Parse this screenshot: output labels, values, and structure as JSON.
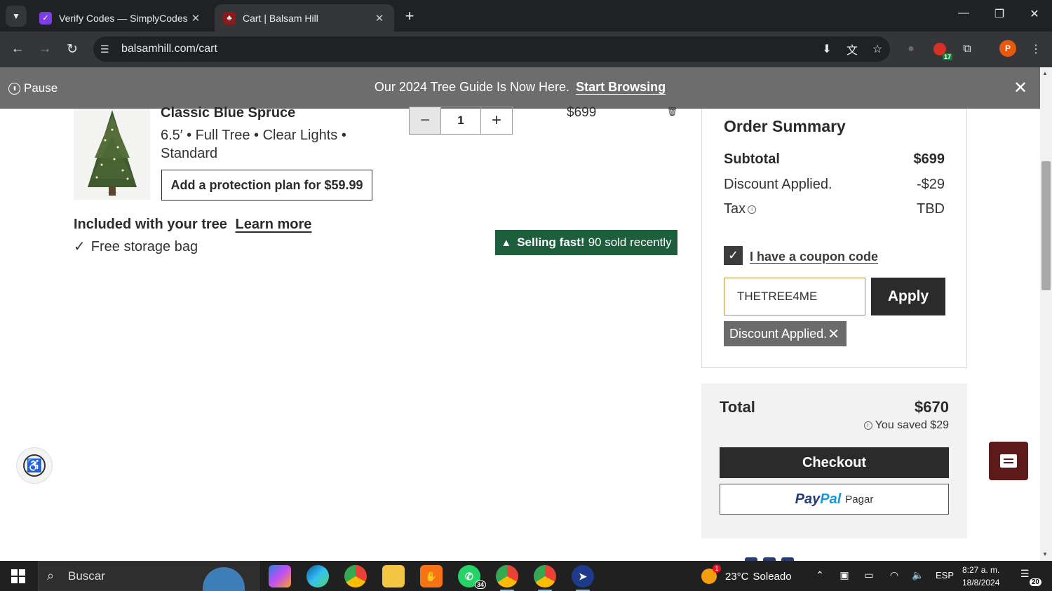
{
  "browser": {
    "tabs": [
      {
        "title": "Verify Codes — SimplyCodes",
        "favicon": "simplycodes-icon",
        "active": false
      },
      {
        "title": "Cart | Balsam Hill",
        "favicon": "balsamhill-icon",
        "active": true
      }
    ],
    "url": "balsamhill.com/cart",
    "extension_badge": "17",
    "profile_initial": "P"
  },
  "promo": {
    "pause_label": "Pause",
    "text": "Our 2024 Tree Guide Is Now Here.",
    "link": "Start Browsing"
  },
  "cart_item": {
    "name": "Classic Blue Spruce",
    "options": "6.5′  •  Full Tree  •  Clear Lights  •  Standard",
    "protection_label": "Add a protection plan for $59.99",
    "quantity": "1",
    "minus": "−",
    "plus": "+",
    "price": "$699",
    "included_title": "Included with your tree",
    "learn_more": "Learn more",
    "included_item": "Free storage bag",
    "selling_bold": "Selling fast!",
    "selling_rest": "90 sold recently"
  },
  "summary": {
    "title": "Order Summary",
    "subtotal_label": "Subtotal",
    "subtotal_value": "$699",
    "discount_label": "Discount Applied.",
    "discount_value": "-$29",
    "tax_label": "Tax",
    "tax_value": "TBD",
    "coupon_label": "I have a coupon code",
    "coupon_checked": true,
    "coupon_value": "THETREE4ME",
    "apply_label": "Apply",
    "chip_label": "Discount Applied."
  },
  "total": {
    "label": "Total",
    "value": "$670",
    "saved": "You saved $29",
    "checkout_label": "Checkout",
    "paypal_pay": "Pay",
    "paypal_pal": "Pal",
    "paypal_text": "Pagar"
  },
  "taskbar": {
    "search_placeholder": "Buscar",
    "whatsapp_badge": "34",
    "weather_temp": "23°C",
    "weather_desc": "Soleado",
    "lang": "ESP",
    "time": "8:27 a. m.",
    "date": "18/8/2024",
    "notifications": "20"
  },
  "colors": {
    "promo_bg": "#6d6d6d",
    "selling_badge": "#1d5e3c",
    "dark_button": "#2b2b2b",
    "chat_button": "#5c1a1a",
    "coupon_border": "#b48a3c"
  }
}
